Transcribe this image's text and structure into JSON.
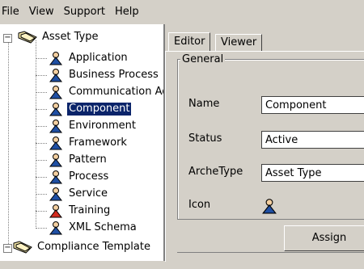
{
  "menu": [
    "File",
    "View",
    "Support",
    "Help"
  ],
  "tree": {
    "root": "Asset Type",
    "children": [
      "Application",
      "Business Process",
      "Communication Ad",
      "Component",
      "Environment",
      "Framework",
      "Pattern",
      "Process",
      "Service",
      "Training",
      "XML Schema"
    ],
    "selected": "Component",
    "second_root": "Compliance Template"
  },
  "tabs": [
    "Editor",
    "Viewer"
  ],
  "active_tab": "Editor",
  "general": {
    "title": "General",
    "name_label": "Name",
    "name_value": "Component",
    "status_label": "Status",
    "status_value": "Active",
    "archetype_label": "ArcheType",
    "archetype_value": "Asset Type",
    "icon_label": "Icon",
    "assign_label": "Assign"
  },
  "colors": {
    "selection": "#0a246a",
    "person_icon": "#1f4fa3",
    "training_icon": "#d22b1f",
    "folder": "#f4e6a6"
  }
}
